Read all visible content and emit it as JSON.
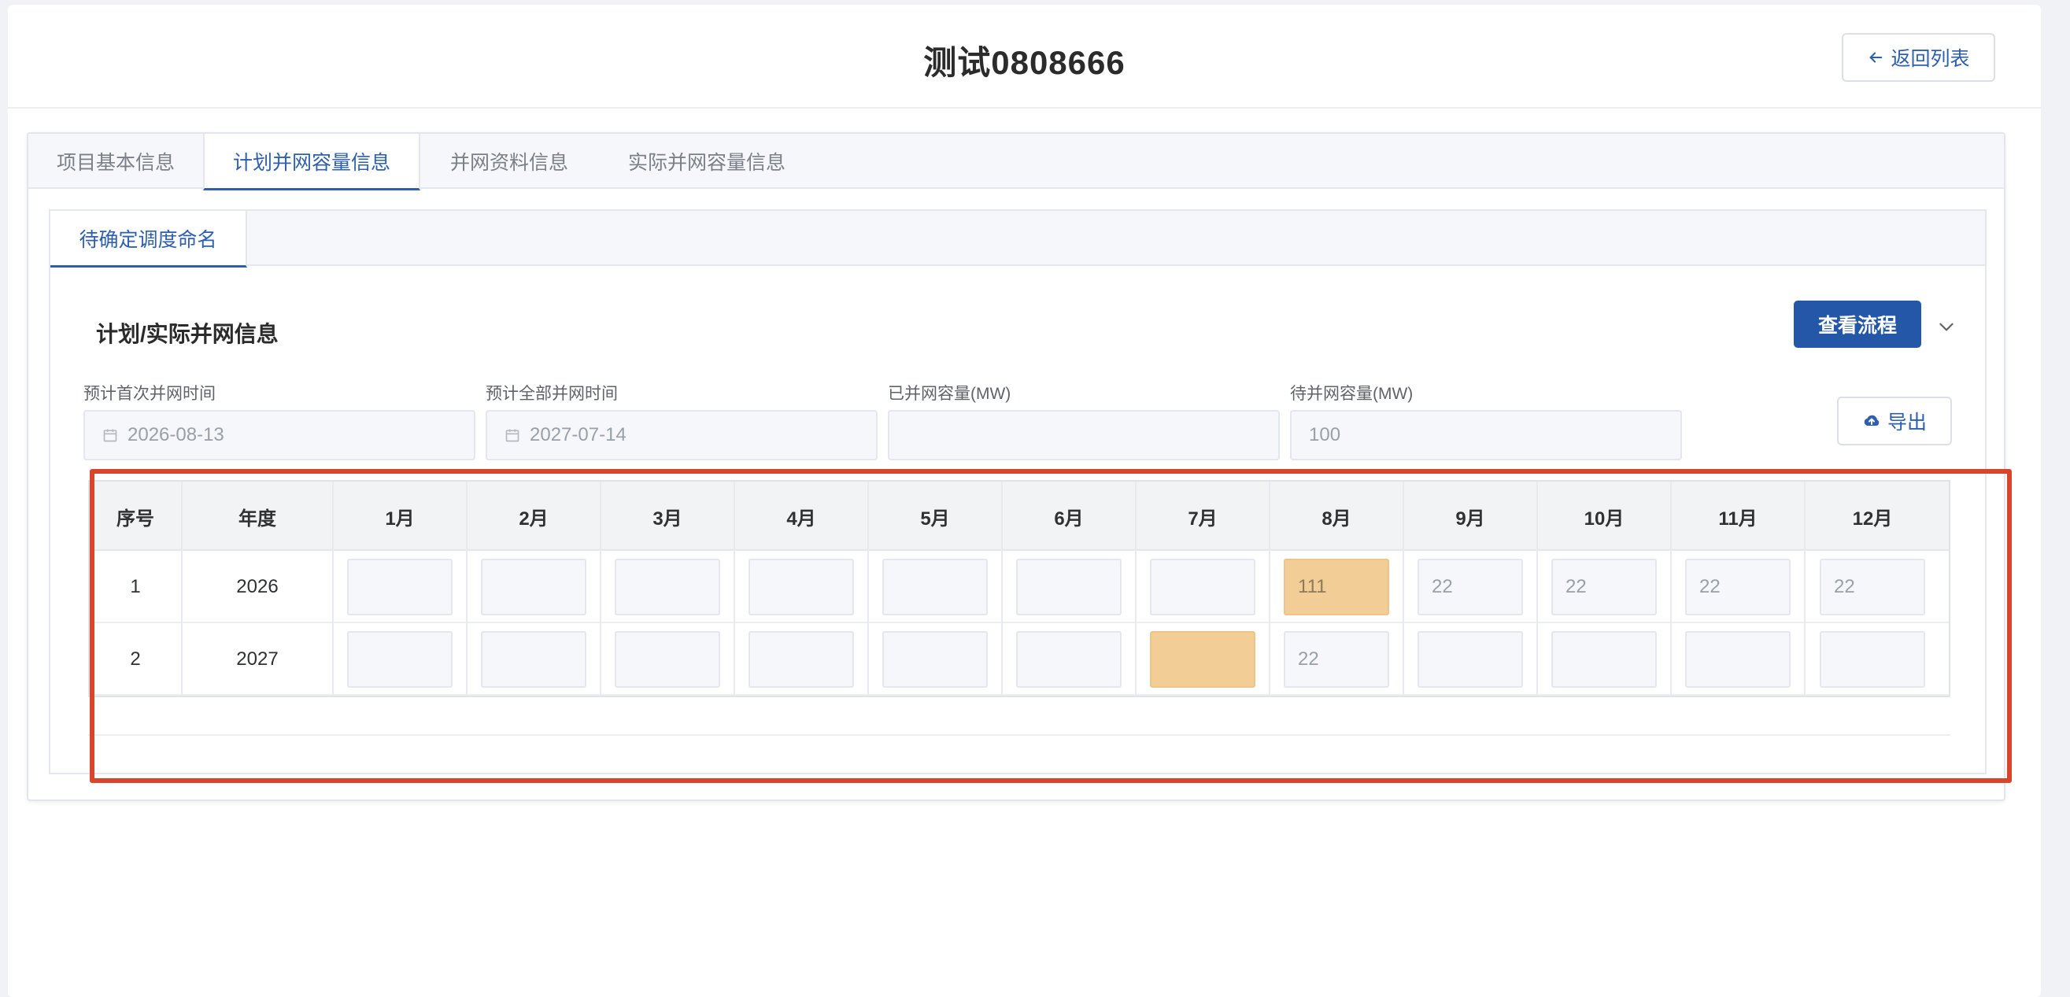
{
  "header": {
    "title": "测试0808666",
    "back_label": "返回列表"
  },
  "tabs": [
    {
      "label": "项目基本信息"
    },
    {
      "label": "计划并网容量信息"
    },
    {
      "label": "并网资料信息"
    },
    {
      "label": "实际并网容量信息"
    }
  ],
  "active_tab_index": 1,
  "inner_tab": {
    "label": "待确定调度命名"
  },
  "section": {
    "title": "计划/实际并网信息",
    "flow_button": "查看流程",
    "export_button": "导出"
  },
  "fields": [
    {
      "label": "预计首次并网时间",
      "value": "2026-08-13",
      "icon": "calendar-icon"
    },
    {
      "label": "预计全部并网时间",
      "value": "2027-07-14",
      "icon": "calendar-icon"
    },
    {
      "label": "已并网容量(MW)",
      "value": ""
    },
    {
      "label": "待并网容量(MW)",
      "value": "100"
    }
  ],
  "table": {
    "headers": [
      "序号",
      "年度",
      "1月",
      "2月",
      "3月",
      "4月",
      "5月",
      "6月",
      "7月",
      "8月",
      "9月",
      "10月",
      "11月",
      "12月"
    ],
    "rows": [
      {
        "index": "1",
        "year": "2026",
        "months": [
          "",
          "",
          "",
          "",
          "",
          "",
          "",
          "111",
          "22",
          "22",
          "22",
          "22"
        ],
        "highlighted": [
          7
        ]
      },
      {
        "index": "2",
        "year": "2027",
        "months": [
          "",
          "",
          "",
          "",
          "",
          "",
          "",
          "22",
          "",
          "",
          "",
          ""
        ],
        "highlighted": [
          6
        ]
      }
    ]
  },
  "colors": {
    "accent": "#2d5fae",
    "primary_button": "#2457a7",
    "highlight_cell": "#f3cd96",
    "annotation_box": "#d9452b"
  }
}
